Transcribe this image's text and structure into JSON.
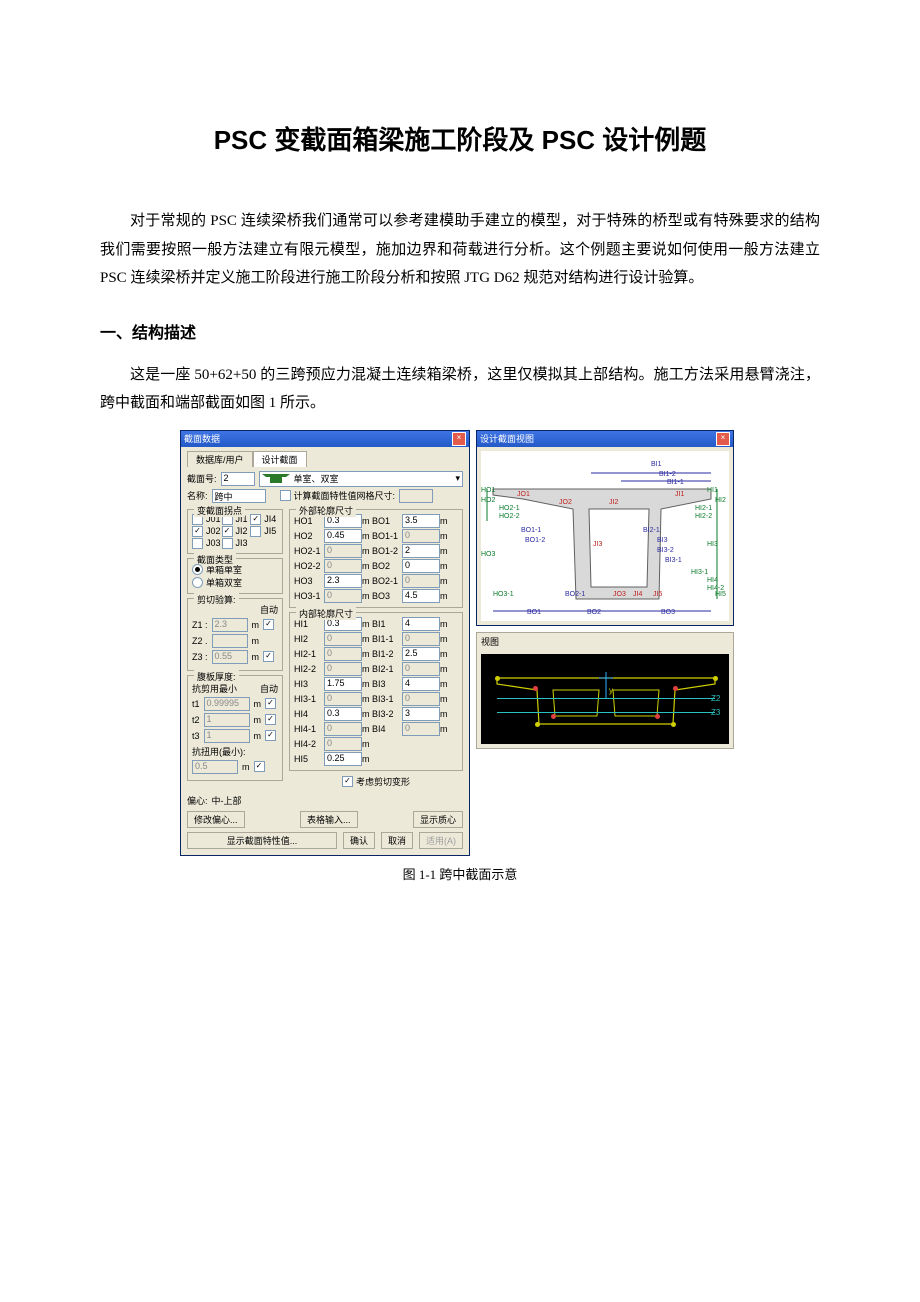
{
  "doc": {
    "title": "PSC 变截面箱梁施工阶段及 PSC 设计例题",
    "para1": "对于常规的 PSC 连续梁桥我们通常可以参考建模助手建立的模型，对于特殊的桥型或有特殊要求的结构我们需要按照一般方法建立有限元模型，施加边界和荷载进行分析。这个例题主要说如何使用一般方法建立 PSC 连续梁桥并定义施工阶段进行施工阶段分析和按照 JTG D62 规范对结构进行设计验算。",
    "section1": "一、结构描述",
    "para2": "这是一座 50+62+50 的三跨预应力混凝土连续箱梁桥，这里仅模拟其上部结构。施工方法采用悬臂浇注，跨中截面和端部截面如图 1 所示。",
    "fig_caption": "图 1-1  跨中截面示意"
  },
  "dlg": {
    "title": "截面数据",
    "tab1": "数据库/用户",
    "tab2": "设计截面",
    "sec_no_lbl": "截面号:",
    "sec_no": "2",
    "type_select": "单室、双室",
    "name_lbl": "名称:",
    "name": "跨中",
    "calc_grid_lbl": "计算截面特性值网格尺寸:",
    "var_group": "变截面拐点",
    "j_opts": [
      {
        "n": "J01",
        "c": false
      },
      {
        "n": "JI1",
        "c": false
      },
      {
        "n": "JI4",
        "c": true
      },
      {
        "n": "J02",
        "c": true
      },
      {
        "n": "JI2",
        "c": true
      },
      {
        "n": "JI5",
        "c": false
      },
      {
        "n": "J03",
        "c": false
      },
      {
        "n": "JI3",
        "c": false
      }
    ],
    "sec_type_group": "截面类型",
    "rb1": "单箱单室",
    "rb2": "单箱双室",
    "ext_group": "外部轮廓尺寸",
    "ext": [
      {
        "k": "HO1",
        "v": "0.3",
        "k2": "BO1",
        "v2": "3.5"
      },
      {
        "k": "HO2",
        "v": "0.45",
        "k2": "BO1-1",
        "v2": "0",
        "g2": true
      },
      {
        "k": "HO2-1",
        "v": "0",
        "g": true,
        "k2": "BO1-2",
        "v2": "2",
        "g2": false
      },
      {
        "k": "HO2-2",
        "v": "0",
        "g": true,
        "k2": "BO2",
        "v2": "0",
        "g2": false
      },
      {
        "k": "HO3",
        "v": "2.3",
        "k2": "BO2-1",
        "v2": "0",
        "g2": true
      },
      {
        "k": "HO3-1",
        "v": "0",
        "g": true,
        "k2": "BO3",
        "v2": "4.5"
      }
    ],
    "inn_group": "内部轮廓尺寸",
    "inn": [
      {
        "k": "HI1",
        "v": "0.3",
        "k2": "BI1",
        "v2": "4"
      },
      {
        "k": "HI2",
        "v": "0",
        "g": true,
        "k2": "BI1-1",
        "v2": "0",
        "g2": true
      },
      {
        "k": "HI2-1",
        "v": "0",
        "g": true,
        "k2": "BI1-2",
        "v2": "2.5"
      },
      {
        "k": "HI2-2",
        "v": "0",
        "g": true,
        "k2": "BI2-1",
        "v2": "0",
        "g2": true
      },
      {
        "k": "HI3",
        "v": "1.75",
        "k2": "BI3",
        "v2": "4"
      },
      {
        "k": "HI3-1",
        "v": "0",
        "g": true,
        "k2": "BI3-1",
        "v2": "0",
        "g2": true
      },
      {
        "k": "HI4",
        "v": "0.3",
        "k2": "BI3-2",
        "v2": "3",
        "g2": false
      },
      {
        "k": "HI4-1",
        "v": "0",
        "g": true,
        "k2": "BI4",
        "v2": "0",
        "g2": true
      },
      {
        "k": "HI4-2",
        "v": "0",
        "g": true,
        "k2": "",
        "v2": ""
      },
      {
        "k": "HI5",
        "v": "0.25",
        "k2": "",
        "v2": ""
      }
    ],
    "shear_group": "剪切验算:",
    "auto": "自动",
    "z1_lbl": "Z1 :",
    "z1": "2.3",
    "z2_lbl": "Z2 .",
    "z3_lbl": "Z3 :",
    "z3": "0.55",
    "web_group": "腹板厚度:",
    "shear_min": "抗剪用最小",
    "t1_lbl": "t1",
    "t1": "0.99995",
    "t2_lbl": "t2",
    "t2": "1",
    "t3_lbl": "t3",
    "t3": "1",
    "tor_min": "抗扭用(最小):",
    "tor": "0.5",
    "shear_deform": "考虑剪切变形",
    "offset_lbl": "偏心:",
    "offset_val": "中-上部",
    "btn_offset": "修改偏心...",
    "btn_table": "表格输入...",
    "btn_show_center": "显示质心",
    "btn_show_prop": "显示截面特性值...",
    "btn_ok": "确认",
    "btn_cancel": "取消",
    "btn_apply": "适用(A)"
  },
  "right": {
    "title1": "设计截面视图",
    "title2": "视图",
    "labels": [
      "BI1",
      "BI1-2",
      "BI1-1",
      "HI1",
      "HI2",
      "HI2-1",
      "HI2-2",
      "HI3",
      "HI3-1",
      "HI4",
      "HI4-1",
      "HI4-2",
      "HI5",
      "HO1",
      "HO2",
      "HO2-1",
      "HO2-2",
      "HO3",
      "HO3-1",
      "BO1",
      "BO2",
      "BO3",
      "BO1-1",
      "BO1-2",
      "BO2-1",
      "BI2-1",
      "BI3",
      "BI3-2",
      "BI3-1",
      "JO1",
      "JO2",
      "JO3",
      "JI1",
      "JI2",
      "JI3",
      "JI4",
      "JI5"
    ],
    "z2": "Z2",
    "z3": "Z3"
  }
}
